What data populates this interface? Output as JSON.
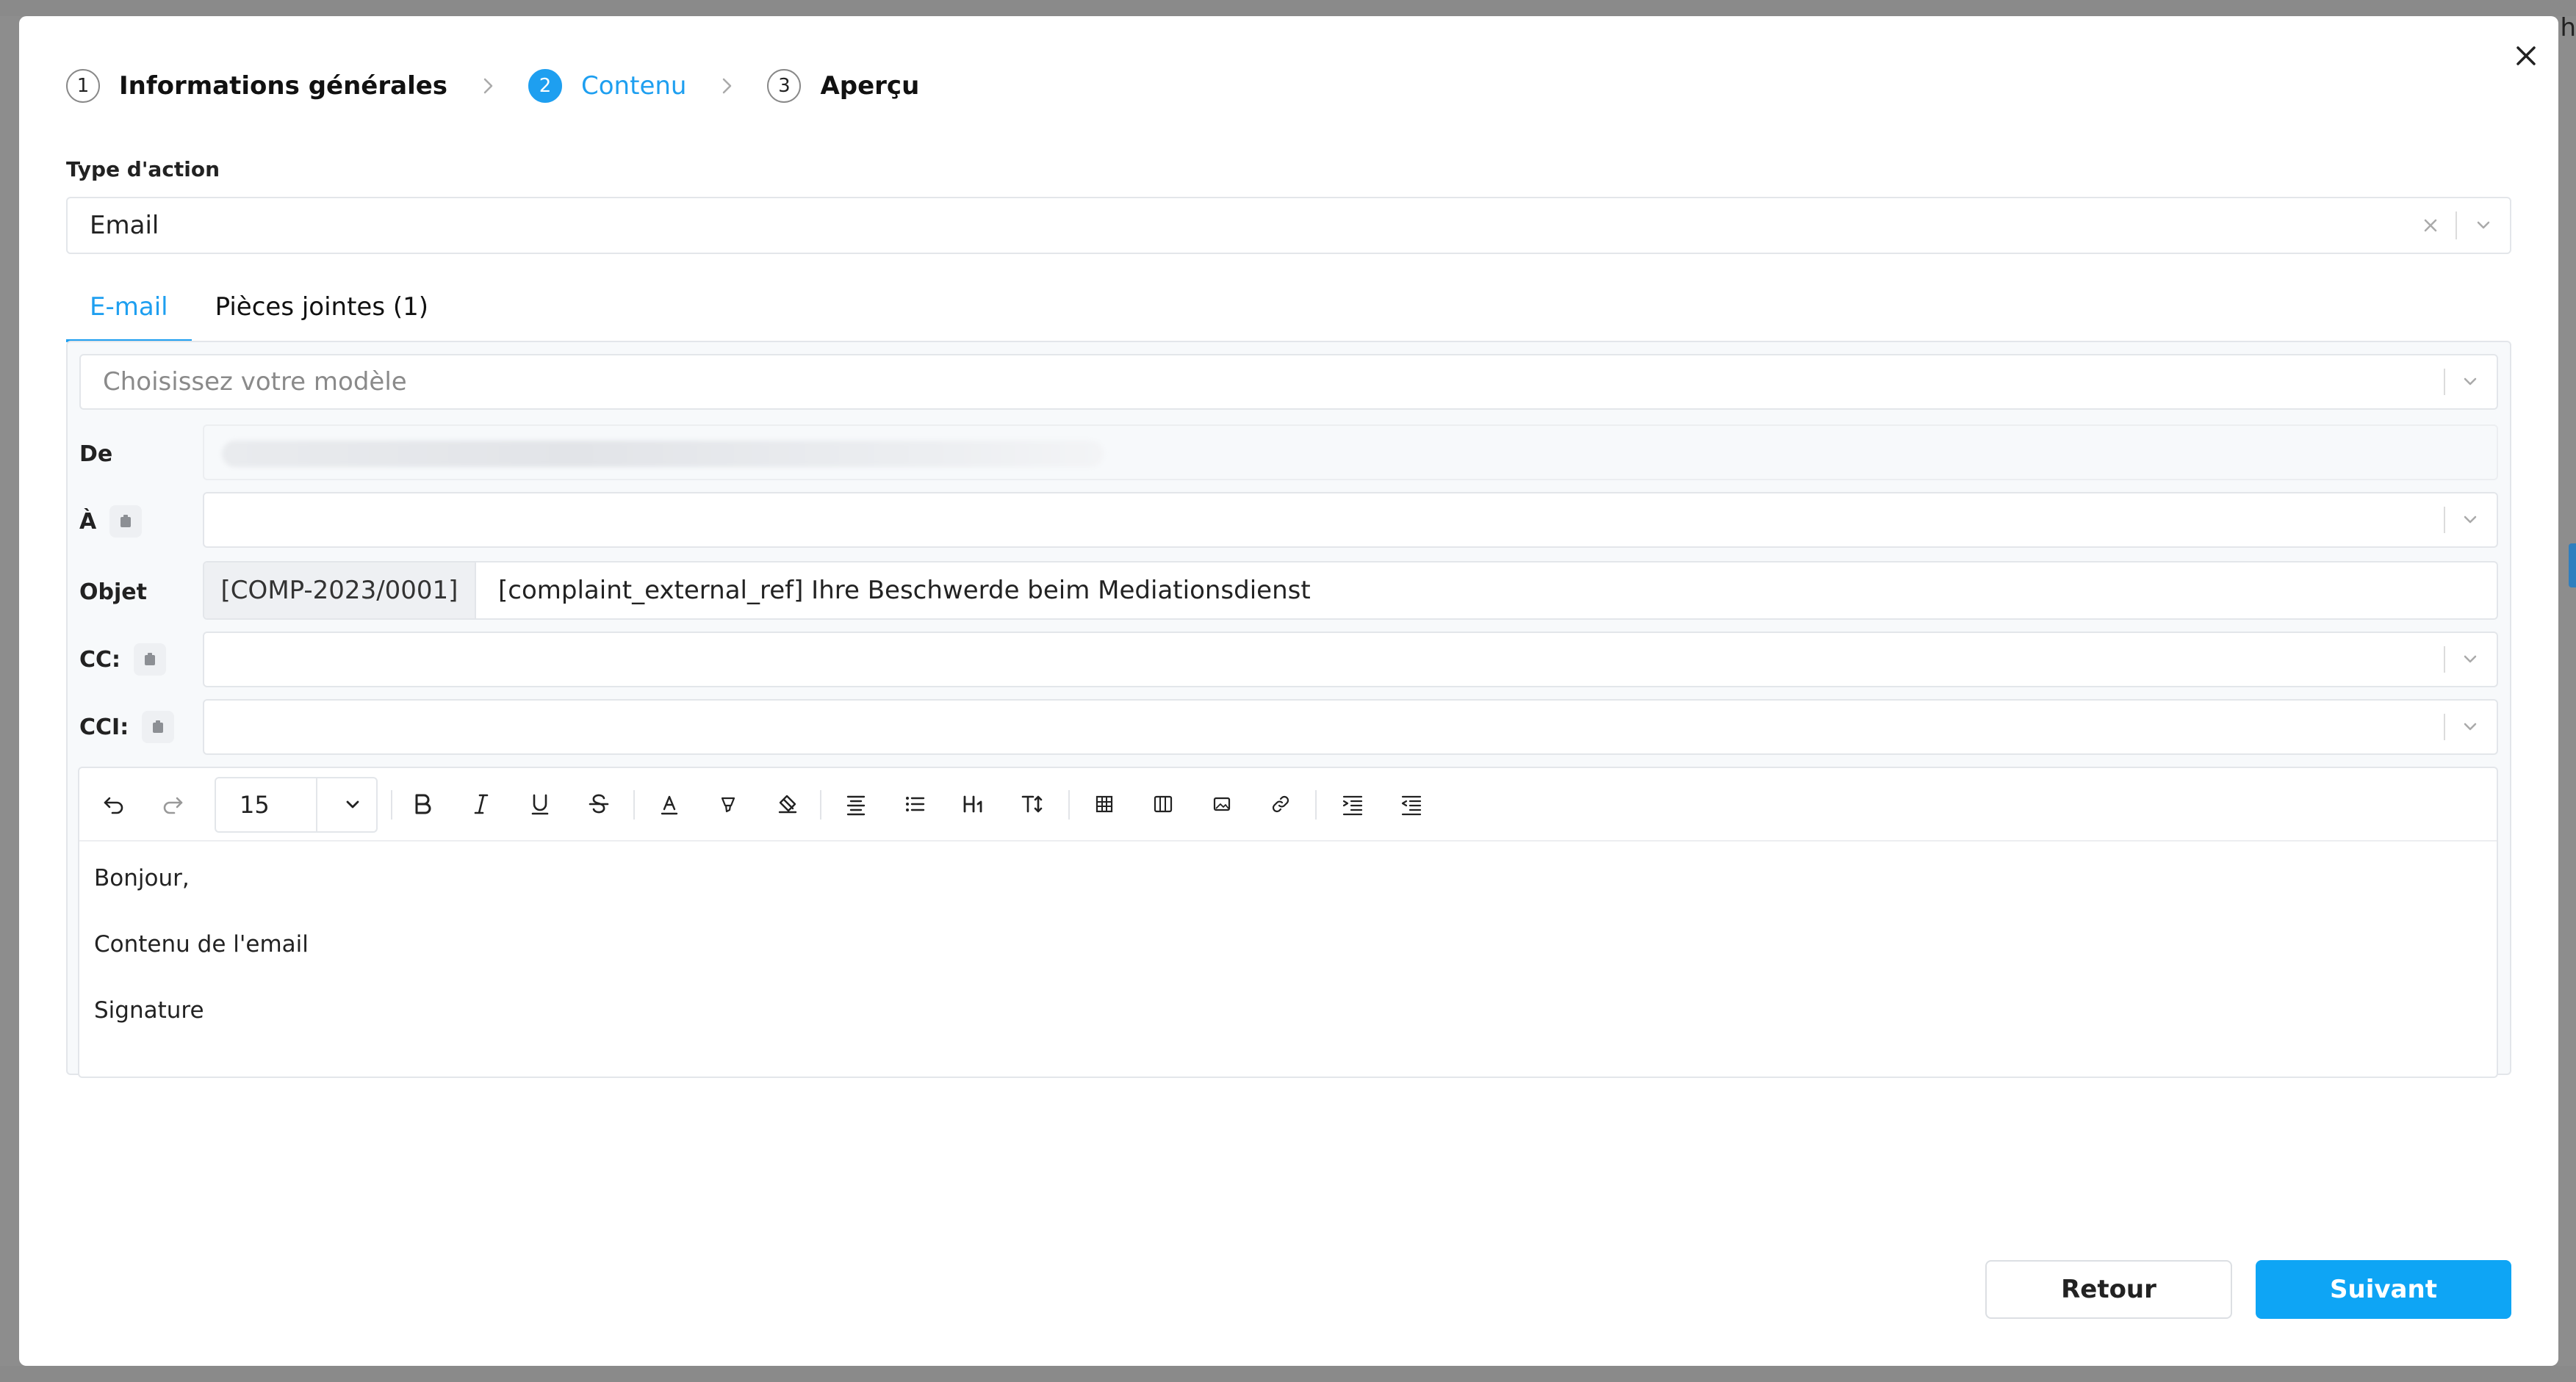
{
  "stepper": {
    "steps": [
      {
        "num": "1",
        "label": "Informations générales"
      },
      {
        "num": "2",
        "label": "Contenu"
      },
      {
        "num": "3",
        "label": "Aperçu"
      }
    ],
    "active_step": 2
  },
  "action_type": {
    "label": "Type d'action",
    "value": "Email"
  },
  "tabs": [
    {
      "label": "E-mail",
      "active": true
    },
    {
      "label": "Pièces jointes (1)",
      "active": false
    }
  ],
  "email": {
    "template_placeholder": "Choisissez votre modèle",
    "from_label": "De",
    "to_label": "À",
    "subject_label": "Objet",
    "subject_prefix": "[COMP-2023/0001]",
    "subject_value": "[complaint_external_ref] Ihre Beschwerde beim Mediationsdienst",
    "cc_label": "CC:",
    "cci_label": "CCI:"
  },
  "editor": {
    "font_size": "15",
    "lines": [
      "Bonjour,",
      "Contenu de l'email",
      "Signature"
    ]
  },
  "buttons": {
    "back": "Retour",
    "next": "Suivant"
  },
  "colors": {
    "accent": "#1e9ff0",
    "primary_button": "#0ea5f5"
  }
}
